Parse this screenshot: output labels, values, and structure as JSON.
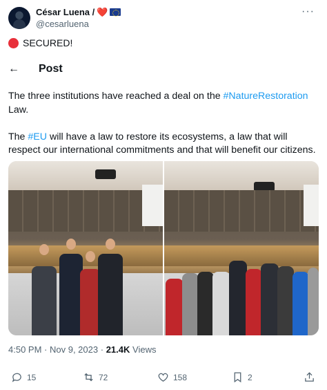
{
  "author": {
    "name": "César Luena /",
    "heart_emoji": "❤️",
    "handle": "@cesarluena"
  },
  "secured_text": "SECURED!",
  "post_header": {
    "back_icon": "back-arrow-icon",
    "title": "Post"
  },
  "tweet": {
    "p1_before": "The three institutions have reached a deal on the ",
    "p1_tag": "#NatureRestoration",
    "p1_after": "Law.",
    "p2_before": "The ",
    "p2_tag": "#EU",
    "p2_after": " will have a law to restore its ecosystems, a law that will respect our international commitments and that will benefit our citizens."
  },
  "meta": {
    "time": "4:50 PM",
    "date": "Nov 9, 2023",
    "views_count": "21.4K",
    "views_label": "Views"
  },
  "actions": {
    "reply": "15",
    "repost": "72",
    "like": "158",
    "bookmark": "2"
  },
  "colors": {
    "link": "#1d9bf0",
    "text": "#0f1419",
    "secondary": "#536471",
    "secured_dot": "#e8303a"
  }
}
